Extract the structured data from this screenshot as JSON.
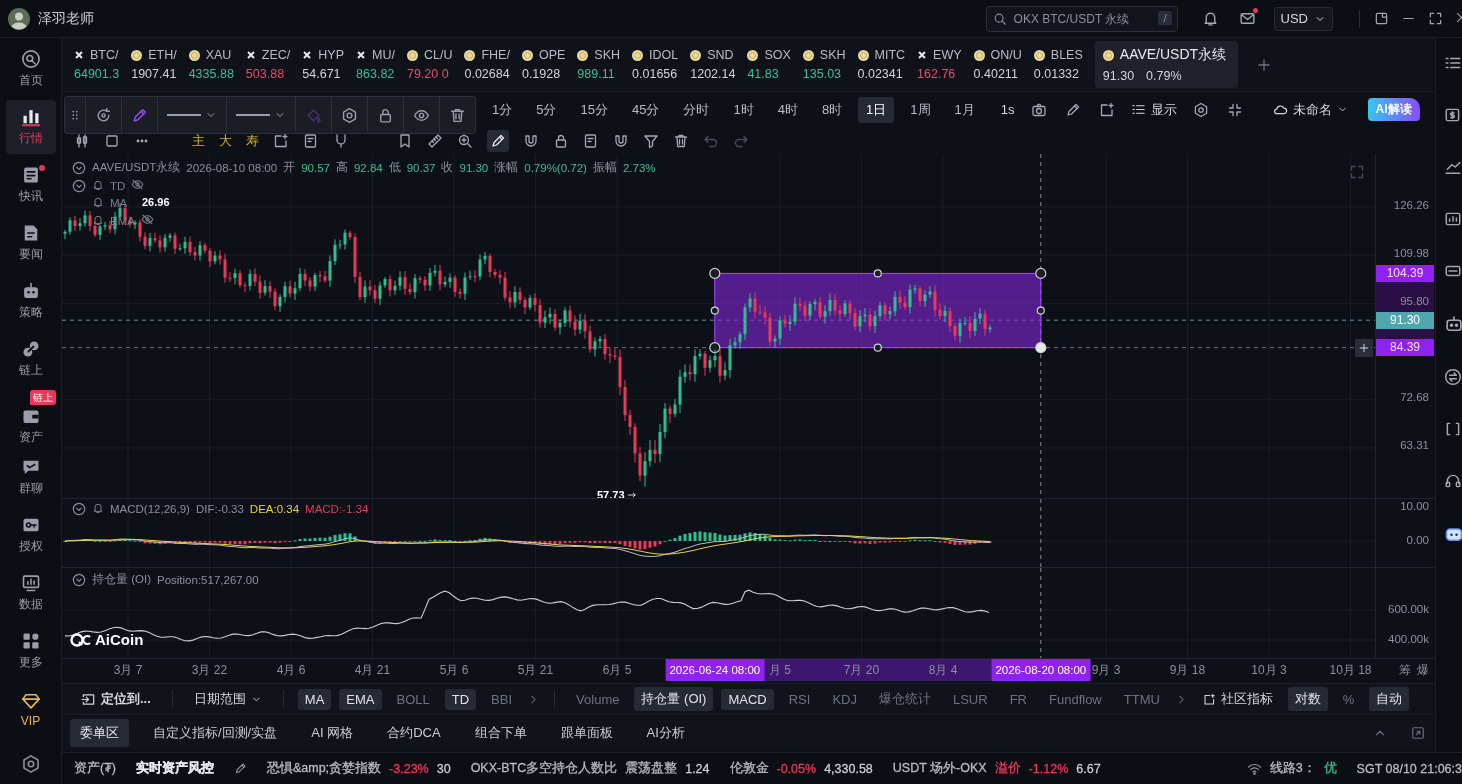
{
  "window": {
    "user": "泽羽老师",
    "search_placeholder": "OKX BTC/USDT 永续",
    "search_shortcut": "/",
    "mail_unread": true,
    "currency": "USD"
  },
  "sidebar": {
    "items": [
      {
        "label": "首页",
        "kind": "nav",
        "selected": false,
        "dot": false
      },
      {
        "label": "行情",
        "kind": "nav",
        "selected": true,
        "dot": false
      },
      {
        "label": "快讯",
        "kind": "nav",
        "selected": false,
        "dot": true
      },
      {
        "label": "要闻",
        "kind": "nav",
        "selected": false,
        "dot": false
      },
      {
        "label": "策略",
        "kind": "nav",
        "selected": false,
        "dot": false
      },
      {
        "label": "链上",
        "kind": "nav",
        "selected": false,
        "dot": false
      },
      {
        "label": "资产",
        "kind": "nav",
        "selected": false,
        "dot": false,
        "badge": "链上"
      },
      {
        "label": "群聊",
        "kind": "nav",
        "selected": false,
        "dot": false
      },
      {
        "label": "授权",
        "kind": "nav",
        "selected": false,
        "dot": false
      },
      {
        "label": "数据",
        "kind": "nav",
        "selected": false,
        "dot": false
      },
      {
        "label": "更多",
        "kind": "nav",
        "selected": false,
        "dot": false
      },
      {
        "label": "VIP",
        "kind": "vip",
        "selected": false,
        "dot": false
      }
    ]
  },
  "tickers": [
    {
      "symbol": "BTC/",
      "price": "64901.3",
      "color": "#3fbf8f",
      "selected": false
    },
    {
      "symbol": "ETH/",
      "price": "1907.41",
      "color": "#d0d3da",
      "selected": false
    },
    {
      "symbol": "XAU",
      "price": "4335.88",
      "color": "#3fbf8f",
      "selected": false
    },
    {
      "symbol": "ZEC/",
      "price": "503.88",
      "color": "#e0506a",
      "selected": false
    },
    {
      "symbol": "HYP",
      "price": "54.671",
      "color": "#d0d3da",
      "selected": false
    },
    {
      "symbol": "MU/",
      "price": "863.82",
      "color": "#3fbf8f",
      "selected": false
    },
    {
      "symbol": "CL/U",
      "price": "79.20 0",
      "color": "#e0506a",
      "selected": false
    },
    {
      "symbol": "FHE/",
      "price": "0.02684",
      "color": "#d0d3da",
      "selected": false
    },
    {
      "symbol": "OPE",
      "price": "0.1928",
      "color": "#d0d3da",
      "selected": false
    },
    {
      "symbol": "SKH",
      "price": "989.11",
      "color": "#3fbf8f",
      "selected": false
    },
    {
      "symbol": "IDOL",
      "price": "0.01656",
      "color": "#d0d3da",
      "selected": false
    },
    {
      "symbol": "SND",
      "price": "1202.14",
      "color": "#d0d3da",
      "selected": false
    },
    {
      "symbol": "SOX",
      "price": "41.83",
      "color": "#3fbf8f",
      "selected": false
    },
    {
      "symbol": "SKH",
      "price": "135.03",
      "color": "#3fbf8f",
      "selected": false
    },
    {
      "symbol": "MITC",
      "price": "0.02341",
      "color": "#d0d3da",
      "selected": false
    },
    {
      "symbol": "EWY",
      "price": "162.76",
      "color": "#e0506a",
      "selected": false
    },
    {
      "symbol": "ON/U",
      "price": "0.40211",
      "color": "#d0d3da",
      "selected": false
    },
    {
      "symbol": "BLES",
      "price": "0.01332",
      "color": "#d0d3da",
      "selected": false
    },
    {
      "symbol": "AAVE/USDT永续",
      "price": "91.30",
      "change": "0.79%",
      "color": "#d0d3da",
      "selected": true
    }
  ],
  "timeframes": [
    {
      "label": "1分",
      "selected": false
    },
    {
      "label": "5分",
      "selected": false
    },
    {
      "label": "15分",
      "selected": false
    },
    {
      "label": "45分",
      "selected": false
    },
    {
      "label": "分时",
      "selected": false
    },
    {
      "label": "1时",
      "selected": false
    },
    {
      "label": "4时",
      "selected": false
    },
    {
      "label": "8时",
      "selected": false
    },
    {
      "label": "1日",
      "selected": true
    },
    {
      "label": "1周",
      "selected": false
    },
    {
      "label": "1月",
      "selected": false
    }
  ],
  "chart_toolbar": {
    "tick_mode": "1s",
    "display": "显示",
    "layout_name": "未命名",
    "ai_button": "AI解读",
    "tool_glyphs": [
      "主",
      "大",
      "寿"
    ]
  },
  "chart": {
    "legend": {
      "symbol": "AAVE/USDT永续",
      "time": "2026-08-10 08:00",
      "fields": [
        {
          "label": "开",
          "value": "90.57"
        },
        {
          "label": "高",
          "value": "92.84"
        },
        {
          "label": "低",
          "value": "90.37"
        },
        {
          "label": "收",
          "value": "91.30"
        },
        {
          "label": "涨幅",
          "value": "0.79%(0.72)"
        },
        {
          "label": "振幅",
          "value": "2.73%"
        }
      ],
      "indicators": [
        "TD",
        "MA",
        "EMA"
      ]
    },
    "high_label": "26.96",
    "low_label": "57.73",
    "price_axis": [
      {
        "text": "126.26",
        "kind": "tick"
      },
      {
        "text": "109.98",
        "kind": "tick"
      },
      {
        "text": "104.39",
        "kind": "range"
      },
      {
        "text": "95.80",
        "kind": "tick"
      },
      {
        "text": "91.30",
        "kind": "last"
      },
      {
        "text": "84.39",
        "kind": "range"
      },
      {
        "text": "72.68",
        "kind": "tick"
      },
      {
        "text": "63.31",
        "kind": "tick"
      }
    ]
  },
  "macd": {
    "title": "MACD(12,26,9)",
    "dif": "DIF:-0.33",
    "dea": "DEA:0.34",
    "macd": "MACD:-1.34",
    "axis": [
      "10.00",
      "0.00"
    ]
  },
  "open_interest": {
    "title": "持仓量 (OI)",
    "position": "Position:517,267.00",
    "axis": [
      "600.00k",
      "400.00k"
    ]
  },
  "logo": "AiCoin",
  "time_axis": {
    "items": [
      {
        "text": "3月 7",
        "kind": "tick"
      },
      {
        "text": "3月 22",
        "kind": "tick"
      },
      {
        "text": "4月 6",
        "kind": "tick"
      },
      {
        "text": "4月 21",
        "kind": "tick"
      },
      {
        "text": "5月 6",
        "kind": "tick"
      },
      {
        "text": "5月 21",
        "kind": "tick"
      },
      {
        "text": "6月 5",
        "kind": "tick"
      },
      {
        "text": "2026-06-24 08:00",
        "kind": "tag"
      },
      {
        "text": "月 5",
        "kind": "tick"
      },
      {
        "text": "7月 20",
        "kind": "tick"
      },
      {
        "text": "8月 4",
        "kind": "tick"
      },
      {
        "text": "2026-08-20 08:00",
        "kind": "tag"
      },
      {
        "text": "9月 3",
        "kind": "tick"
      },
      {
        "text": "9月 18",
        "kind": "tick"
      },
      {
        "text": "10月 3",
        "kind": "tick"
      },
      {
        "text": "10月 18",
        "kind": "tick"
      }
    ],
    "buttons": [
      "筹",
      "爆"
    ]
  },
  "indicator_bar": {
    "locate": "定位到...",
    "date_range": "日期范围",
    "main": [
      {
        "label": "MA",
        "on": true
      },
      {
        "label": "EMA",
        "on": true
      },
      {
        "label": "BOLL",
        "on": false
      },
      {
        "label": "TD",
        "on": true
      },
      {
        "label": "BBI",
        "on": false
      }
    ],
    "sub": [
      {
        "label": "Volume",
        "on": false
      },
      {
        "label": "持仓量 (OI)",
        "on": true
      },
      {
        "label": "MACD",
        "on": true
      },
      {
        "label": "RSI",
        "on": false
      },
      {
        "label": "KDJ",
        "on": false
      },
      {
        "label": "爆仓统计",
        "on": false
      },
      {
        "label": "LSUR",
        "on": false
      },
      {
        "label": "FR",
        "on": false
      },
      {
        "label": "Fundflow",
        "on": false
      },
      {
        "label": "TTMU",
        "on": false
      }
    ],
    "community": "社区指标",
    "scale": [
      {
        "label": "对数",
        "on": true
      },
      {
        "label": "%",
        "on": false
      },
      {
        "label": "自动",
        "on": true
      }
    ]
  },
  "bottom_tabs": [
    {
      "label": "委单区",
      "selected": true
    },
    {
      "label": "自定义指标/回测/实盘",
      "selected": false
    },
    {
      "label": "AI 网格",
      "selected": false
    },
    {
      "label": "合约DCA",
      "selected": false
    },
    {
      "label": "组合下单",
      "selected": false
    },
    {
      "label": "跟单面板",
      "selected": false
    },
    {
      "label": "AI分析",
      "selected": false
    }
  ],
  "status_bar": {
    "groups": [
      [
        {
          "text": "资产(₮)",
          "color": "#b7bac3"
        }
      ],
      [
        {
          "text": "实时资产风控",
          "color": "#e6e8ee"
        }
      ],
      [
        {
          "text": "恐惧&amp;贪婪指数",
          "color": "#b7bac3"
        },
        {
          "text": "-3.23%",
          "color": "#e8395a"
        },
        {
          "text": "30",
          "color": "#c9ccd4"
        }
      ],
      [
        {
          "text": "OKX-BTC多空持仓人数比",
          "color": "#b7bac3"
        },
        {
          "text": "震荡盘整",
          "color": "#b7bac3"
        },
        {
          "text": "1.24",
          "color": "#c9ccd4"
        }
      ],
      [
        {
          "text": "伦敦金",
          "color": "#b7bac3"
        },
        {
          "text": "-0.05%",
          "color": "#e8395a"
        },
        {
          "text": "4,330.58",
          "color": "#c9ccd4"
        }
      ],
      [
        {
          "text": "USDT 场外-OKX",
          "color": "#b7bac3"
        },
        {
          "text": "溢价",
          "color": "#e8395a"
        },
        {
          "text": "-1.12%",
          "color": "#e8395a"
        },
        {
          "text": "6.67",
          "color": "#c9ccd4"
        }
      ],
      [
        {
          "text": "线路3：",
          "color": "#b7bac3"
        },
        {
          "text": "优",
          "color": "#3fbf8f"
        }
      ],
      [
        {
          "text": "SGT 08/10 21:06:3",
          "color": "#b7bac3"
        }
      ]
    ]
  }
}
